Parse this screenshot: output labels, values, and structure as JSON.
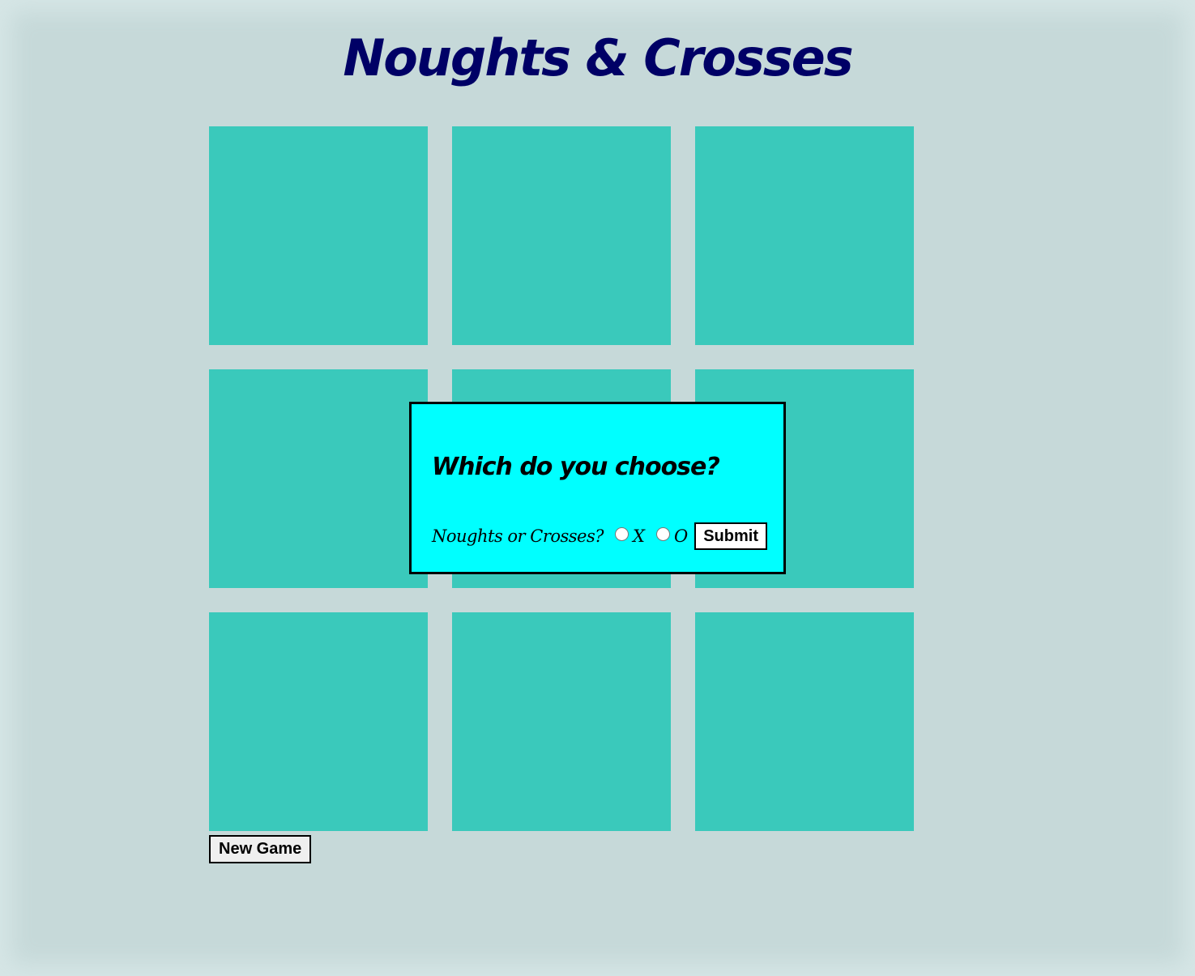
{
  "title": "Noughts & Crosses",
  "board": {
    "cells": [
      "",
      "",
      "",
      "",
      "",
      "",
      "",
      "",
      ""
    ]
  },
  "new_game_label": "New Game",
  "dialog": {
    "heading": "Which do you choose?",
    "question": "Noughts or Crosses?",
    "options": [
      {
        "label": "X",
        "selected": false
      },
      {
        "label": "O",
        "selected": false
      }
    ],
    "submit_label": "Submit"
  },
  "colors": {
    "background": "#c6d9d9",
    "cell": "#3ac9bb",
    "title": "#000066",
    "dialog_background": "#00ffff",
    "border": "#000000"
  }
}
